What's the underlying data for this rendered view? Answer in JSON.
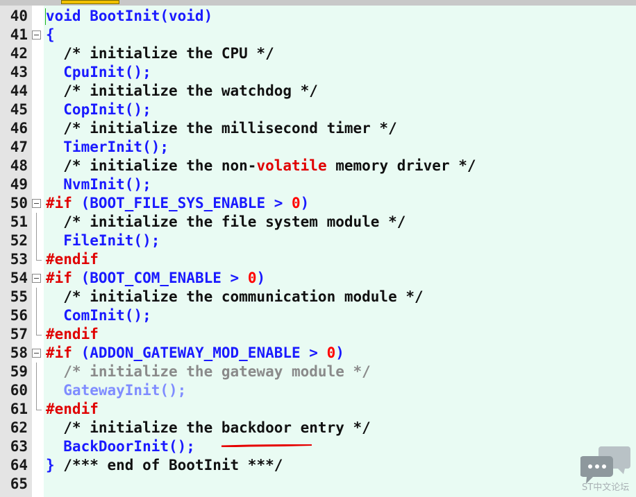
{
  "editor": {
    "lines": [
      {
        "n": "40",
        "parts": [
          [
            "kw",
            "void BootInit(void)"
          ]
        ]
      },
      {
        "n": "41",
        "fold": "start",
        "parts": [
          [
            "kw",
            "{"
          ]
        ]
      },
      {
        "n": "42",
        "parts": [
          [
            "cm",
            "  /* initialize the CPU */"
          ]
        ]
      },
      {
        "n": "43",
        "parts": [
          [
            "fn",
            "  CpuInit();"
          ]
        ]
      },
      {
        "n": "44",
        "parts": [
          [
            "cm",
            "  /* initialize the watchdog */"
          ]
        ]
      },
      {
        "n": "45",
        "parts": [
          [
            "fn",
            "  CopInit();"
          ]
        ]
      },
      {
        "n": "46",
        "parts": [
          [
            "cm",
            "  /* initialize the millisecond timer */"
          ]
        ]
      },
      {
        "n": "47",
        "parts": [
          [
            "fn",
            "  TimerInit();"
          ]
        ]
      },
      {
        "n": "48",
        "parts": [
          [
            "cm",
            "  /* initialize the non-"
          ],
          [
            "pp",
            "volatile"
          ],
          [
            "cm",
            " memory driver */"
          ]
        ]
      },
      {
        "n": "49",
        "parts": [
          [
            "fn",
            "  NvmInit();"
          ]
        ]
      },
      {
        "n": "50",
        "fold": "start",
        "parts": [
          [
            "pp",
            "#if"
          ],
          [
            "kw",
            " (BOOT_FILE_SYS_ENABLE > "
          ],
          [
            "num",
            "0"
          ],
          [
            "kw",
            ")"
          ]
        ]
      },
      {
        "n": "51",
        "fold": "mid",
        "parts": [
          [
            "cm",
            "  /* initialize the file system module */"
          ]
        ]
      },
      {
        "n": "52",
        "fold": "mid",
        "parts": [
          [
            "fn",
            "  FileInit();"
          ]
        ]
      },
      {
        "n": "53",
        "fold": "end",
        "parts": [
          [
            "pp",
            "#endif"
          ]
        ]
      },
      {
        "n": "54",
        "fold": "start",
        "parts": [
          [
            "pp",
            "#if"
          ],
          [
            "kw",
            " (BOOT_COM_ENABLE > "
          ],
          [
            "num",
            "0"
          ],
          [
            "kw",
            ")"
          ]
        ]
      },
      {
        "n": "55",
        "fold": "mid",
        "parts": [
          [
            "cm",
            "  /* initialize the communication module */"
          ]
        ]
      },
      {
        "n": "56",
        "fold": "mid",
        "parts": [
          [
            "fn",
            "  ComInit();"
          ]
        ]
      },
      {
        "n": "57",
        "fold": "end",
        "parts": [
          [
            "pp",
            "#endif"
          ]
        ]
      },
      {
        "n": "58",
        "fold": "start",
        "parts": [
          [
            "pp",
            "#if"
          ],
          [
            "kw",
            " (ADDON_GATEWAY_MOD_ENABLE > "
          ],
          [
            "num",
            "0"
          ],
          [
            "kw",
            ")"
          ]
        ]
      },
      {
        "n": "59",
        "fold": "mid",
        "parts": [
          [
            "dimc",
            "  /* initialize the gateway module */"
          ]
        ]
      },
      {
        "n": "60",
        "fold": "mid",
        "parts": [
          [
            "dim",
            "  GatewayInit();"
          ]
        ]
      },
      {
        "n": "61",
        "fold": "end",
        "parts": [
          [
            "pp",
            "#endif"
          ]
        ]
      },
      {
        "n": "62",
        "parts": [
          [
            "cm",
            "  /* initialize the backdoor entry */"
          ]
        ]
      },
      {
        "n": "63",
        "parts": [
          [
            "fn",
            "  BackDoorInit();"
          ]
        ]
      },
      {
        "n": "64",
        "parts": [
          [
            "kw",
            "} "
          ],
          [
            "cm",
            "/*** end of BootInit ***/"
          ]
        ]
      },
      {
        "n": "65",
        "parts": []
      }
    ]
  },
  "colors": {
    "keyword": "#1a1aff",
    "comment": "#111111",
    "preprocessor": "#e00000",
    "number": "#ff0000",
    "disabled_code": "#7f8cff",
    "disabled_comment": "#8a8a8a",
    "background": "#e9fbf3",
    "annotation_mark": "#e60000"
  },
  "watermark": {
    "icon": "chat-bubbles-icon",
    "text": "ST中文论坛"
  }
}
